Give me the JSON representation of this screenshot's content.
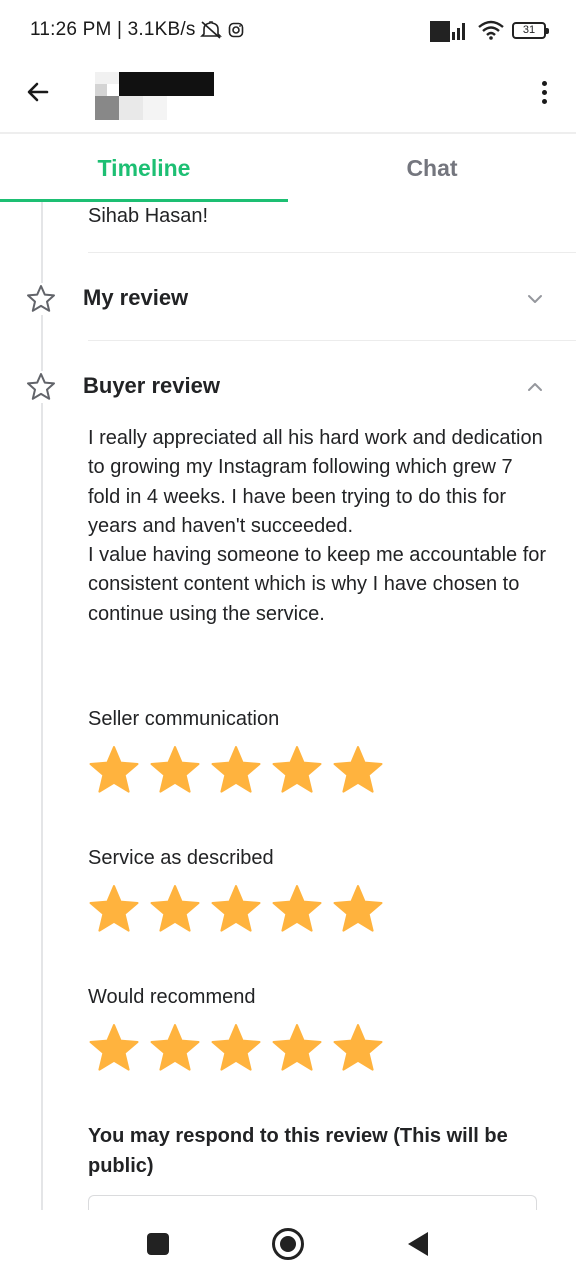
{
  "status_bar": {
    "time_and_speed": "11:26 PM | 3.1KB/s",
    "battery": "31"
  },
  "tabs": [
    {
      "label": "Timeline",
      "active": true
    },
    {
      "label": "Chat",
      "active": false
    }
  ],
  "timeline": {
    "previous_message_tail": "Sihab Hasan!",
    "my_review": {
      "title": "My review",
      "expanded": false
    },
    "buyer_review": {
      "title": "Buyer review",
      "expanded": true,
      "paragraph_1": "I really appreciated all his hard work and dedication to growing my Instagram following which grew 7 fold in 4 weeks. I have been trying to do this for years and haven't succeeded.",
      "paragraph_2": "I value having someone to keep me accountable for consistent content which is why I have chosen to continue using the service.",
      "ratings": [
        {
          "label": "Seller communication",
          "stars": 5
        },
        {
          "label": "Service as described",
          "stars": 5
        },
        {
          "label": "Would recommend",
          "stars": 5
        }
      ]
    },
    "respond_prompt": "You may respond to this review (This will be public)"
  },
  "colors": {
    "accent": "#1dbf73",
    "star": "#ffb33e",
    "inactive_tab": "#74767e",
    "text": "#222325"
  },
  "icons": {
    "back": "arrow-left-icon",
    "menu": "more-vertical-icon",
    "section": "star-outline-icon",
    "collapse": "chevron-up-icon",
    "expand": "chevron-down-icon"
  }
}
